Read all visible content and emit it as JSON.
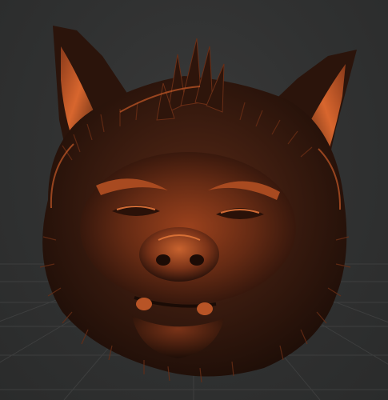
{
  "viewport": {
    "background_color": "#303131",
    "grid_color": "#3b3c3c"
  },
  "model": {
    "subject": "sculpted-creature-head",
    "material": {
      "base_color": "#3a1d12",
      "highlight_color": "#c85a2a",
      "rim_color": "#e06a32",
      "shadow_color": "#1a0c07"
    }
  }
}
